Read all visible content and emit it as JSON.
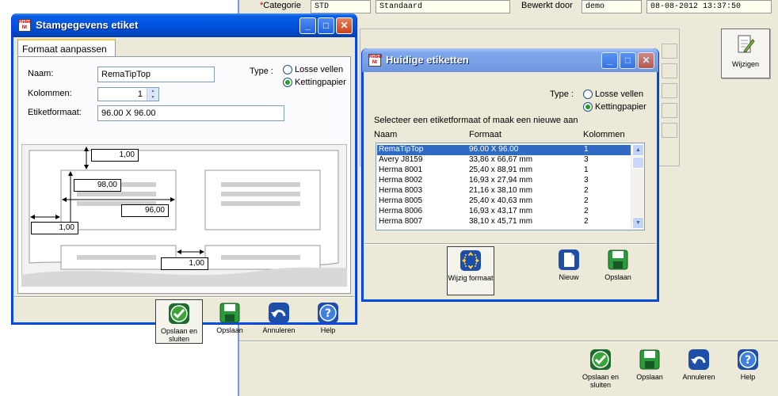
{
  "background": {
    "category_label": "Categorie",
    "category_code": "STD",
    "category_name": "Standaard",
    "edited_by_label": "Bewerkt door",
    "edited_by_value": "demo",
    "edited_at": "08-08-2012 13:37:50",
    "edit_button": "Wijzigen",
    "toolbar": {
      "save_close": "Opslaan en sluiten",
      "save": "Opslaan",
      "cancel": "Annuleren",
      "help": "Help"
    }
  },
  "stamgegevens_window": {
    "title": "Stamgegevens etiket",
    "tab": "Formaat aanpassen",
    "name_label": "Naam:",
    "name_value": "RemaTipTop",
    "columns_label": "Kolommen:",
    "columns_value": "1",
    "format_label": "Etiketformaat:",
    "format_value": "96.00 X 96.00",
    "type_label": "Type :",
    "type_options": [
      "Losse vellen",
      "Kettingpapier"
    ],
    "type_selected": "Kettingpapier",
    "diagram": {
      "top_margin": "1,00",
      "label_height": "98,00",
      "label_width": "96,00",
      "left_margin": "1,00",
      "horizontal_gap": "1,00"
    },
    "buttons": {
      "save_close": "Opslaan en sluiten",
      "save": "Opslaan",
      "cancel": "Annuleren",
      "help": "Help"
    }
  },
  "huidige_window": {
    "title": "Huidige etiketten",
    "type_label": "Type :",
    "type_options": [
      "Losse vellen",
      "Kettingpapier"
    ],
    "type_selected": "Kettingpapier",
    "instruction": "Selecteer een etiketformaat of maak een nieuwe aan",
    "columns": [
      "Naam",
      "Formaat",
      "Kolommen"
    ],
    "rows": [
      {
        "name": "RemaTipTop",
        "format": "96.00 X 96.00",
        "cols": "1"
      },
      {
        "name": "Avery J8159",
        "format": "33,86 x 66,67 mm",
        "cols": "3"
      },
      {
        "name": "Herma 8001",
        "format": "25,40 x 88,91 mm",
        "cols": "1"
      },
      {
        "name": "Herma 8002",
        "format": "16,93 x 27,94 mm",
        "cols": "3"
      },
      {
        "name": "Herma 8003",
        "format": "21,16 x 38,10 mm",
        "cols": "2"
      },
      {
        "name": "Herma 8005",
        "format": "25,40 x 40,63 mm",
        "cols": "2"
      },
      {
        "name": "Herma 8006",
        "format": "16,93 x 43,17 mm",
        "cols": "2"
      },
      {
        "name": "Herma 8007",
        "format": "38,10 x 45,71 mm",
        "cols": "2"
      }
    ],
    "selected_row": 0,
    "buttons": {
      "edit_format": "Wijzig formaat",
      "new": "Nieuw",
      "save": "Opslaan"
    }
  },
  "colors": {
    "xp_title_blue": "#0054e3",
    "selection": "#316ac5",
    "window_face": "#ece9d8",
    "required_marker": "#c00000"
  }
}
